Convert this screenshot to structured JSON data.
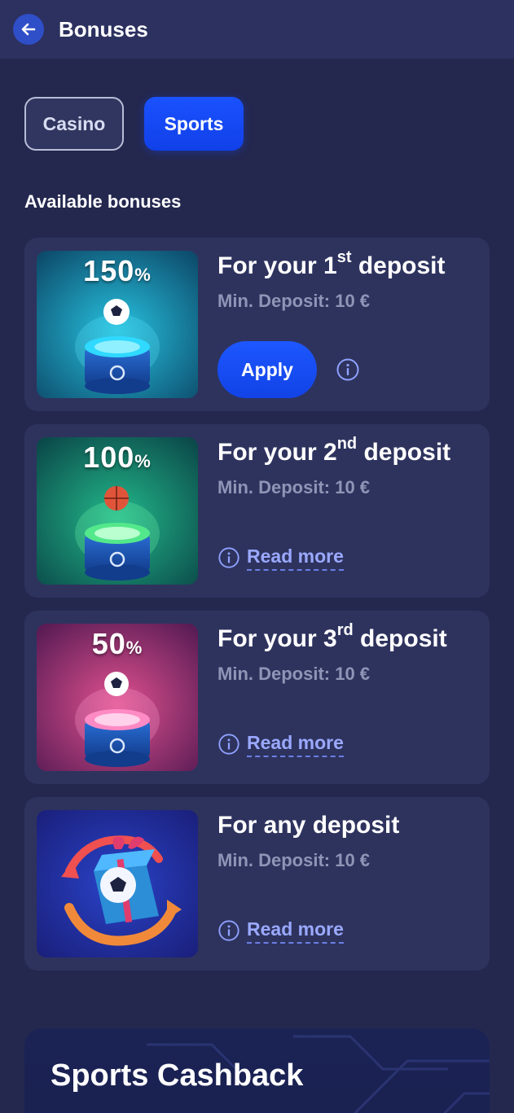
{
  "header": {
    "title": "Bonuses",
    "back_icon": "arrow-left-icon"
  },
  "tabs": [
    {
      "label": "Casino",
      "active": false
    },
    {
      "label": "Sports",
      "active": true
    }
  ],
  "section_label": "Available bonuses",
  "bonuses": [
    {
      "title_prefix": "For your 1",
      "title_sup": "st",
      "title_suffix": " deposit",
      "percent": "150",
      "percent_sign": "%",
      "min_deposit": "Min. Deposit: 10 €",
      "apply_label": "Apply",
      "theme": "teal",
      "ball": "football-icon"
    },
    {
      "title_prefix": "For your 2",
      "title_sup": "nd",
      "title_suffix": " deposit",
      "percent": "100",
      "percent_sign": "%",
      "min_deposit": "Min. Deposit: 10 €",
      "read_more": "Read more",
      "theme": "green",
      "ball": "basketball-icon"
    },
    {
      "title_prefix": "For your 3",
      "title_sup": "rd",
      "title_suffix": " deposit",
      "percent": "50",
      "percent_sign": "%",
      "min_deposit": "Min. Deposit: 10 €",
      "read_more": "Read more",
      "theme": "pink",
      "ball": "football-icon"
    },
    {
      "title_prefix": "For any deposit",
      "title_sup": "",
      "title_suffix": "",
      "min_deposit": "Min. Deposit: 10 €",
      "read_more": "Read more",
      "theme": "gift",
      "ball": "gift-box-icon"
    }
  ],
  "cashback": {
    "title": "Sports Cashback"
  },
  "colors": {
    "background": "#24284f",
    "card": "#2e335e",
    "accent": "#1a52ff",
    "link": "#9aa9ff"
  }
}
